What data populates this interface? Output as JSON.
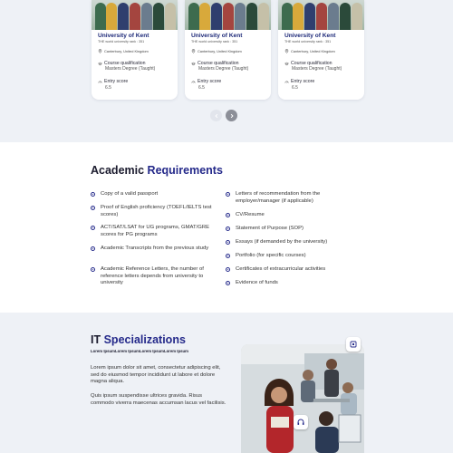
{
  "cards": [
    {
      "title": "University of Kent",
      "rank": "THE world university rank : 351",
      "location": "Canterbury, United Kingdom",
      "course_label": "Course qualification",
      "course_value": "Masters Degree (Taught)",
      "entry_label": "Entry score",
      "entry_value": "6.5"
    },
    {
      "title": "University of Kent",
      "rank": "THE world university rank : 351",
      "location": "Canterbury, United Kingdom",
      "course_label": "Course qualification",
      "course_value": "Masters Degree (Taught)",
      "entry_label": "Entry score",
      "entry_value": "6.5"
    },
    {
      "title": "University of Kent",
      "rank": "THE world university rank : 351",
      "location": "Canterbury, United Kingdom",
      "course_label": "Course qualification",
      "course_value": "Masters Degree (Taught)",
      "entry_label": "Entry score",
      "entry_value": "6.5"
    }
  ],
  "pager": {
    "prev_icon": "chevron-left-icon",
    "next_icon": "chevron-right-icon"
  },
  "academic": {
    "title_plain": "Academic",
    "title_highlight": "Requirements",
    "left_items": [
      "Copy of a valid passport",
      "Proof of English proficiency (TOEFL/IELTS test scores)",
      "ACT/SAT/LSAT for UG programs, GMAT/GRE scores for PG programs",
      "Academic Transcripts from the previous study",
      "Academic Reference Letters, the number of reference letters depends from university to university"
    ],
    "right_items": [
      "Letters of recommendation from the employer/manager (if applicable)",
      "CV/Resume",
      "Statement of Purpose (SOP)",
      "Essays (if demanded by the university)",
      "Portfolio (for specific courses)",
      "Certificates of extracurricular activities",
      "Evidence of funds"
    ]
  },
  "it": {
    "title_plain": "IT",
    "title_highlight": "Specializations",
    "subtitle": "Lorem IpsumLorem IpsumLorem IpsumLorem Ipsum",
    "paragraph_1": "Lorem ipsum dolor sit amet, consectetur adipiscing elit, sed do eiusmod tempor incididunt ut labore et dolore magna aliqua.",
    "paragraph_2": "Quis ipsum suspendisse ultrices gravida. Risus commodo viverra maecenas accumsan lacus vel facilisis."
  },
  "colors": {
    "accent": "#24298a",
    "band_bg": "#eef1f6",
    "pager_active": "#8c8f98"
  }
}
